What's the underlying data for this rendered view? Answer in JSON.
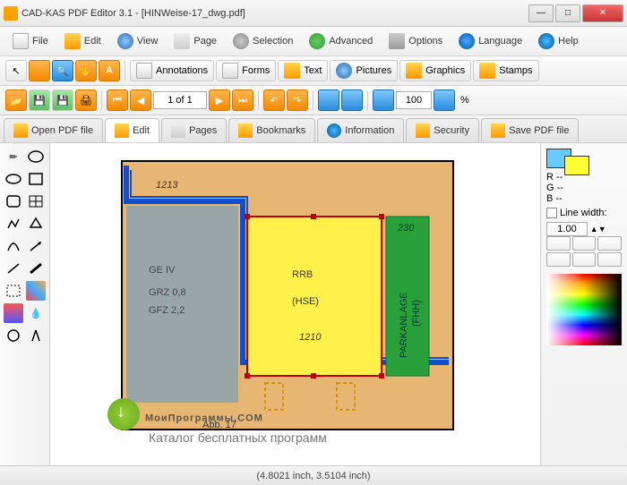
{
  "window": {
    "title": "CAD-KAS PDF Editor 3.1 - [HINWeise-17_dwg.pdf]"
  },
  "menu": {
    "file": "File",
    "edit": "Edit",
    "view": "View",
    "page": "Page",
    "selection": "Selection",
    "advanced": "Advanced",
    "options": "Options",
    "language": "Language",
    "help": "Help"
  },
  "toolbar2": {
    "annotations": "Annotations",
    "forms": "Forms",
    "text": "Text",
    "pictures": "Pictures",
    "graphics": "Graphics",
    "stamps": "Stamps"
  },
  "nav": {
    "page_display": "1 of 1",
    "zoom": "100",
    "zoom_suffix": "%"
  },
  "tabs": {
    "open": "Open PDF file",
    "edit": "Edit",
    "pages": "Pages",
    "bookmarks": "Bookmarks",
    "information": "Information",
    "security": "Security",
    "save": "Save PDF file"
  },
  "drawing": {
    "label_1213": "1213",
    "label_geiv": "GE IV",
    "label_grz": "GRZ 0,8",
    "label_gfz": "GFZ 2,2",
    "label_rrb": "RRB",
    "label_hse": "(HSE)",
    "label_1210": "1210",
    "label_230": "230",
    "label_park": "PARKANLAGE",
    "label_fhh": "(FHH)",
    "label_abb": "Abb. 17"
  },
  "right": {
    "r": "R --",
    "g": "G --",
    "b": "B --",
    "linewidth_label": "Line width:",
    "linewidth_value": "1.00"
  },
  "status": {
    "coords": "(4.8021 inch, 3.5104 inch)"
  },
  "watermark": {
    "line1": "МоиПрограммы.COM",
    "line2": "Каталог бесплатных программ"
  }
}
